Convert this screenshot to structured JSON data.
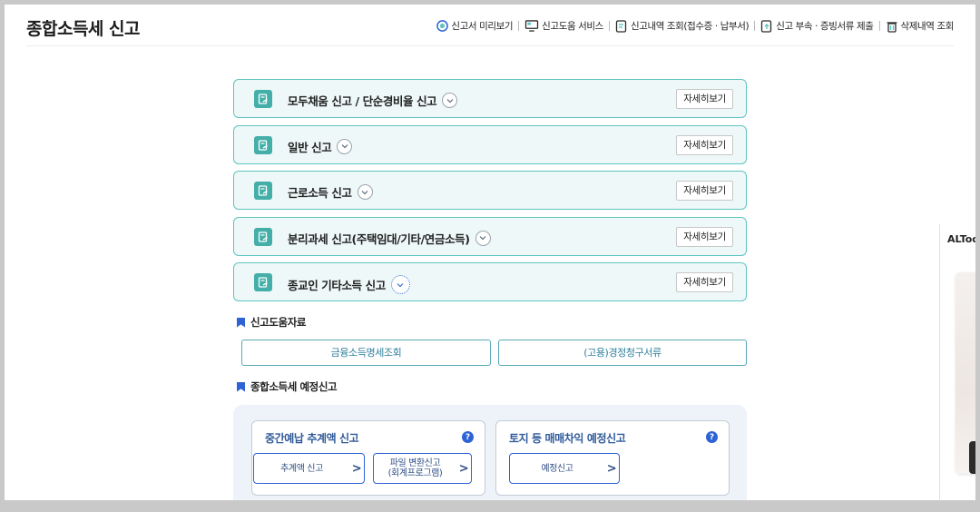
{
  "header": {
    "title": "종합소득세 신고",
    "links": [
      {
        "label": "신고서 미리보기",
        "icon": "preview-icon"
      },
      {
        "label": "신고도움 서비스",
        "icon": "monitor-icon"
      },
      {
        "label": "신고내역 조회(접수증 · 납부서)",
        "icon": "document-search-icon"
      },
      {
        "label": "신고 부속 · 증빙서류 제출",
        "icon": "document-upload-icon"
      },
      {
        "label": "삭제내역 조회",
        "icon": "trash-icon"
      }
    ]
  },
  "cards": [
    {
      "label": "모두채움 신고 / 단순경비율 신고",
      "detail": "자세히보기"
    },
    {
      "label": "일반 신고",
      "detail": "자세히보기"
    },
    {
      "label": "근로소득 신고",
      "detail": "자세히보기"
    },
    {
      "label": "분리과세 신고(주택임대/기타/연금소득)",
      "detail": "자세히보기"
    },
    {
      "label": "종교인 기타소득 신고",
      "detail": "자세히보기"
    }
  ],
  "help": {
    "title": "신고도움자료",
    "buttons": [
      "금융소득명세조회",
      "(고용)경정청구서류"
    ]
  },
  "estimate": {
    "title": "종합소득세 예정신고",
    "boxes": [
      {
        "title": "중간예납 추계액 신고",
        "help": "?",
        "buttons": [
          {
            "label": "추계액 신고",
            "arrow": ">"
          },
          {
            "label": "파일 변환신고\n(회계프로그램)",
            "arrow": ">"
          }
        ]
      },
      {
        "title": "토지 등 매매차익 예정신고",
        "help": "?",
        "buttons": [
          {
            "label": "예정신고",
            "arrow": ">"
          }
        ]
      }
    ]
  },
  "side_panel": {
    "title": "ALTools"
  },
  "colors": {
    "card_border": "#5fc4c0",
    "card_bg": "#eef8f8",
    "card_icon": "#44aea9",
    "accent_blue": "#2e63d6",
    "help_border": "#57aab4"
  }
}
